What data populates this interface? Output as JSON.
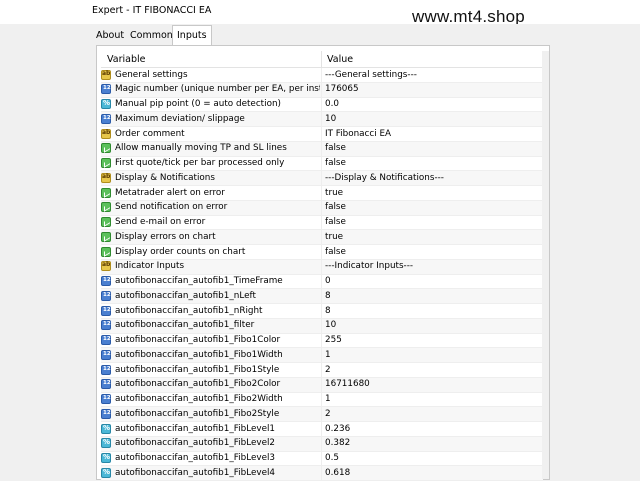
{
  "window": {
    "title": "Expert - IT FIBONACCI EA",
    "watermark": "www.mt4.shop"
  },
  "tabs": [
    {
      "label": "About"
    },
    {
      "label": "Common"
    },
    {
      "label": "Inputs"
    }
  ],
  "table": {
    "headers": {
      "variable": "Variable",
      "value": "Value"
    },
    "rows": [
      {
        "icon": "ab",
        "name": "General settings",
        "value": "---General settings---"
      },
      {
        "icon": "num",
        "name": "Magic number (unique number per EA, per insta...",
        "value": "176065"
      },
      {
        "icon": "dbl",
        "name": "Manual pip point (0 = auto detection)",
        "value": "0.0"
      },
      {
        "icon": "num",
        "name": "Maximum deviation/ slippage",
        "value": "10"
      },
      {
        "icon": "ab",
        "name": "Order comment",
        "value": "IT Fibonacci EA"
      },
      {
        "icon": "bool",
        "name": "Allow manually moving TP and SL lines",
        "value": "false"
      },
      {
        "icon": "bool",
        "name": "First quote/tick per bar processed only",
        "value": "false"
      },
      {
        "icon": "ab",
        "name": "Display & Notifications",
        "value": "---Display & Notifications---"
      },
      {
        "icon": "bool",
        "name": "Metatrader alert on error",
        "value": "true"
      },
      {
        "icon": "bool",
        "name": "Send notification on error",
        "value": "false"
      },
      {
        "icon": "bool",
        "name": "Send e-mail on error",
        "value": "false"
      },
      {
        "icon": "bool",
        "name": "Display errors on chart",
        "value": "true"
      },
      {
        "icon": "bool",
        "name": "Display order counts on chart",
        "value": "false"
      },
      {
        "icon": "ab",
        "name": "Indicator Inputs",
        "value": "---Indicator Inputs---"
      },
      {
        "icon": "num",
        "name": "autofibonaccifan_autofib1_TimeFrame",
        "value": "0"
      },
      {
        "icon": "num",
        "name": "autofibonaccifan_autofib1_nLeft",
        "value": "8"
      },
      {
        "icon": "num",
        "name": "autofibonaccifan_autofib1_nRight",
        "value": "8"
      },
      {
        "icon": "num",
        "name": "autofibonaccifan_autofib1_filter",
        "value": "10"
      },
      {
        "icon": "clr",
        "name": "autofibonaccifan_autofib1_Fibo1Color",
        "value": "255"
      },
      {
        "icon": "num",
        "name": "autofibonaccifan_autofib1_Fibo1Width",
        "value": "1"
      },
      {
        "icon": "num",
        "name": "autofibonaccifan_autofib1_Fibo1Style",
        "value": "2"
      },
      {
        "icon": "clr",
        "name": "autofibonaccifan_autofib1_Fibo2Color",
        "value": "16711680"
      },
      {
        "icon": "num",
        "name": "autofibonaccifan_autofib1_Fibo2Width",
        "value": "1"
      },
      {
        "icon": "num",
        "name": "autofibonaccifan_autofib1_Fibo2Style",
        "value": "2"
      },
      {
        "icon": "dbl",
        "name": "autofibonaccifan_autofib1_FibLevel1",
        "value": "0.236"
      },
      {
        "icon": "dbl",
        "name": "autofibonaccifan_autofib1_FibLevel2",
        "value": "0.382"
      },
      {
        "icon": "dbl",
        "name": "autofibonaccifan_autofib1_FibLevel3",
        "value": "0.5"
      },
      {
        "icon": "dbl",
        "name": "autofibonaccifan_autofib1_FibLevel4",
        "value": "0.618"
      }
    ]
  },
  "icons": {
    "ab": "string-param-icon",
    "num": "integer-param-icon",
    "dbl": "double-param-icon",
    "bool": "bool-param-icon",
    "clr": "color-param-icon"
  }
}
